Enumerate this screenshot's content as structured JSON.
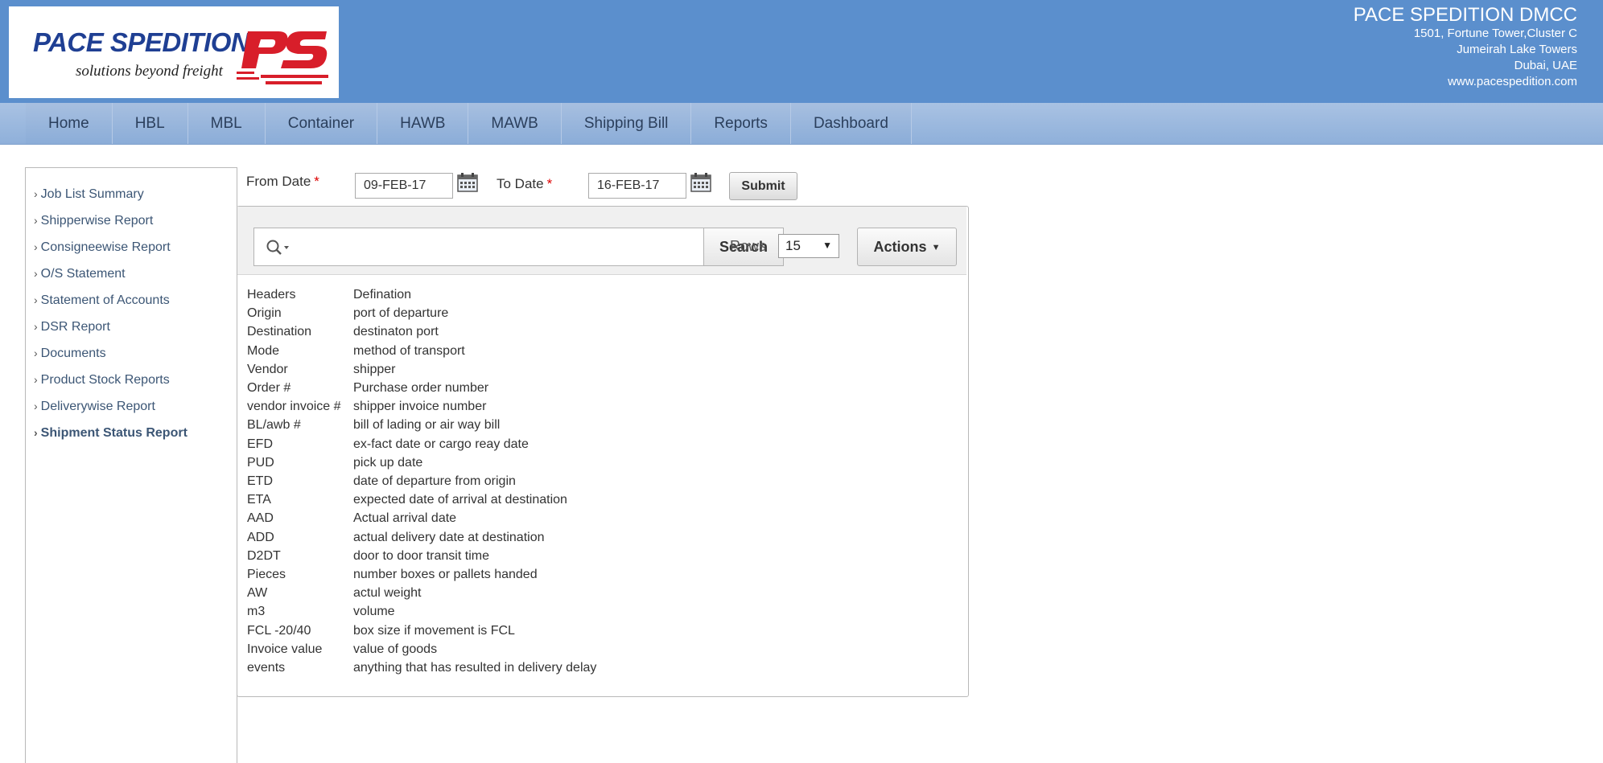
{
  "header": {
    "logo": {
      "title": "PACE SPEDITION",
      "tagline": "solutions beyond freight",
      "mark": "PS"
    },
    "company_name": "PACE SPEDITION DMCC",
    "address_lines": [
      "1501, Fortune Tower,Cluster C",
      "Jumeirah Lake Towers",
      "Dubai, UAE",
      "www.pacespedition.com"
    ],
    "colors": {
      "header_bg": "#5b8fcd",
      "logo_blue": "#1f3f93",
      "logo_red": "#d81e2a"
    }
  },
  "nav": {
    "items": [
      "Home",
      "HBL",
      "MBL",
      "Container",
      "HAWB",
      "MAWB",
      "Shipping Bill",
      "Reports",
      "Dashboard"
    ]
  },
  "sidebar": {
    "items": [
      {
        "label": "Job List Summary"
      },
      {
        "label": "Shipperwise Report"
      },
      {
        "label": "Consigneewise Report"
      },
      {
        "label": "O/S Statement"
      },
      {
        "label": "Statement of Accounts"
      },
      {
        "label": "DSR Report"
      },
      {
        "label": "Documents"
      },
      {
        "label": "Product Stock Reports"
      },
      {
        "label": "Deliverywise Report"
      },
      {
        "label": "Shipment Status Report"
      }
    ],
    "active_index": 9
  },
  "filters": {
    "from_label": "From Date",
    "from_value": "09-FEB-17",
    "to_label": "To Date",
    "to_value": "16-FEB-17",
    "required_marker": "*",
    "submit_label": "Submit"
  },
  "toolbar": {
    "search_placeholder": "",
    "search_label": "Search",
    "rows_label": "Rows",
    "rows_value": "15",
    "actions_label": "Actions"
  },
  "definitions": [
    {
      "key": "Headers",
      "value": "Defination"
    },
    {
      "key": "Origin",
      "value": "port of departure"
    },
    {
      "key": "Destination",
      "value": "destinaton port"
    },
    {
      "key": "Mode",
      "value": "method of transport"
    },
    {
      "key": "Vendor",
      "value": "shipper"
    },
    {
      "key": "Order #",
      "value": "Purchase order number"
    },
    {
      "key": "vendor invoice #",
      "value": "shipper invoice number"
    },
    {
      "key": "BL/awb #",
      "value": "bill of lading or air way bill"
    },
    {
      "key": "EFD",
      "value": "ex-fact date or cargo reay date"
    },
    {
      "key": "PUD",
      "value": "pick up date"
    },
    {
      "key": "ETD",
      "value": "date of departure from origin"
    },
    {
      "key": "ETA",
      "value": "expected date of arrival at destination"
    },
    {
      "key": "AAD",
      "value": "Actual arrival date"
    },
    {
      "key": "ADD",
      "value": "actual delivery date at destination"
    },
    {
      "key": "D2DT",
      "value": "door to door transit time"
    },
    {
      "key": "Pieces",
      "value": "number boxes or pallets handed"
    },
    {
      "key": "AW",
      "value": "actul weight"
    },
    {
      "key": "m3",
      "value": "volume"
    },
    {
      "key": "FCL -20/40",
      "value": "box size if movement is FCL"
    },
    {
      "key": "Invoice value",
      "value": "value of goods"
    },
    {
      "key": "events",
      "value": "anything that has resulted in delivery delay"
    }
  ]
}
